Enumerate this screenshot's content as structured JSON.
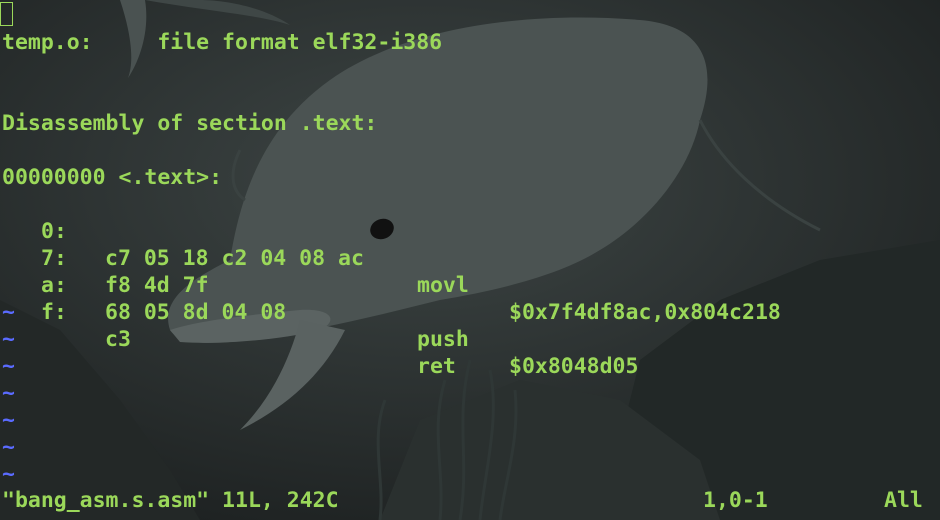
{
  "file_header": "temp.o:     file format elf32-i386",
  "section_title": "Disassembly of section .text:",
  "symbol_label": "00000000 <.text>:",
  "instructions": [
    {
      "addr": "0:",
      "bytes": "c7 05 18 c2 04 08 ac",
      "mnemonic": "movl",
      "operands": "$0x7f4df8ac,0x804c218"
    },
    {
      "addr": "7:",
      "bytes": "f8 4d 7f",
      "mnemonic": "",
      "operands": ""
    },
    {
      "addr": "a:",
      "bytes": "68 05 8d 04 08",
      "mnemonic": "push",
      "operands": "$0x8048d05"
    },
    {
      "addr": "f:",
      "bytes": "c3",
      "mnemonic": "ret",
      "operands": ""
    }
  ],
  "tilde_char": "~",
  "status": {
    "file_info": "\"bang_asm.s.asm\" 11L, 242C",
    "position": "1,0-1",
    "scroll": "All"
  },
  "colors": {
    "text": "#9bd85a",
    "tilde": "#5a6bff"
  }
}
